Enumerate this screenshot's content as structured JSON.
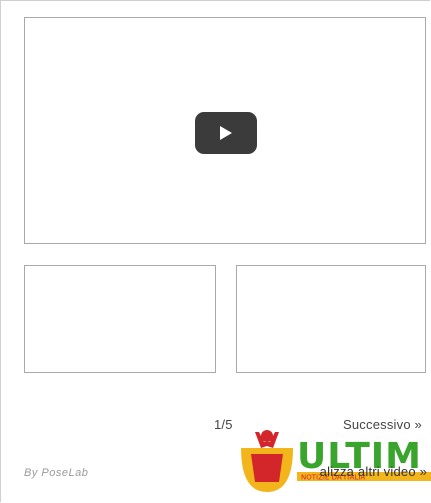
{
  "player": {
    "play_icon": "play-icon"
  },
  "thumbnails": [
    {
      "label": ""
    },
    {
      "label": ""
    }
  ],
  "pagination": {
    "counter": "1/5",
    "next_label": "Successivo »"
  },
  "footer": {
    "credit": "By PoseLab",
    "more_videos_label": "alizza altri video »"
  },
  "logo": {
    "name": "ultimi-logo",
    "text": "ULTIM",
    "tagline": "NOTIZIE DA ITALIA"
  },
  "colors": {
    "border": "#a9a9a9",
    "play_button": "#3b3b3b",
    "logo_green": "#3aa52c",
    "logo_red": "#d3262b",
    "logo_yellow": "#f2b51c"
  }
}
